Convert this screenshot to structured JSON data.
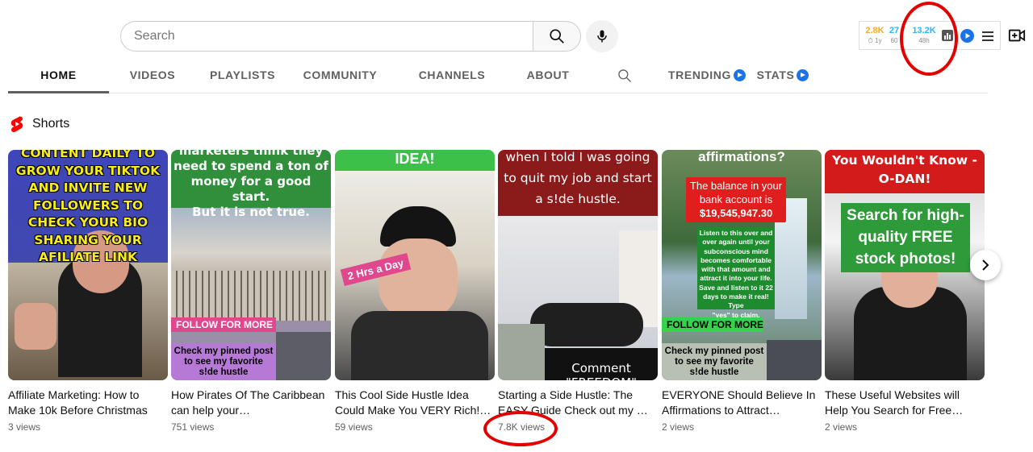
{
  "search": {
    "placeholder": "Search"
  },
  "extension": {
    "stat1": {
      "value": "2.8K",
      "sub": "1y",
      "color": "#f9a825"
    },
    "stat2": {
      "value": "27",
      "sub": "60",
      "color": "#29b6f6"
    },
    "stat3": {
      "value": "13.2K",
      "sub": "48h",
      "color": "#29b6f6"
    }
  },
  "tabs": [
    {
      "label": "HOME"
    },
    {
      "label": "VIDEOS"
    },
    {
      "label": "PLAYLISTS"
    },
    {
      "label": "COMMUNITY"
    },
    {
      "label": "CHANNELS"
    },
    {
      "label": "ABOUT"
    },
    {
      "label": "TRENDING"
    },
    {
      "label": "STATS"
    }
  ],
  "shorts": {
    "title": "Shorts",
    "items": [
      {
        "title": "Affiliate Marketing: How to Make 10k Before Christmas",
        "views": "3 views",
        "overlay": [
          "CONTENT DAILY TO",
          "GROW YOUR TIKTOK",
          "AND INVITE NEW",
          "FOLLOWERS TO",
          "CHECK YOUR BIO",
          "SHARING YOUR",
          "AFILIATE LINK"
        ]
      },
      {
        "title": "How Pirates Of The Caribbean can help your…",
        "views": "751 views",
        "overlay": [
          "marketers think they",
          "need to spend a ton of",
          "money for a good start.",
          "But it is not true."
        ],
        "follow": "FOLLOW FOR MORE",
        "pinned": [
          "Check my pinned post",
          "to see my favorite",
          "s!de hustle"
        ]
      },
      {
        "title": "This Cool Side Hustle Idea Could Make You VERY Rich!…",
        "views": "59 views",
        "overlay": [
          "IDEA!"
        ],
        "tag": "2 Hrs a Day"
      },
      {
        "title": "Starting a Side Hustle: The EASY Guide Check out my …",
        "views": "7.8K views",
        "overlay": [
          "when I told I was going",
          "to quit my job and start",
          "a s!de hustle."
        ],
        "comment": "Comment \"FREEDOM\""
      },
      {
        "title": "EVERYONE Should Believe In Affirmations to Attract…",
        "views": "2 views",
        "overlay": [
          "affirmations?"
        ],
        "balance": [
          "The balance in your",
          "bank account is",
          "$19,545,947.30"
        ],
        "listen": [
          "Listen to this over and",
          "over again until your",
          "subconscious mind",
          "becomes comfortable",
          "with that amount and",
          "attract it into your life.",
          "Save and listen to it 22",
          "days to make it real! Type",
          "\"yes\" to claim."
        ],
        "follow": "FOLLOW FOR MORE",
        "pinned": [
          "Check my pinned post",
          "to see my favorite",
          "s!de hustle"
        ]
      },
      {
        "title": "These Useful Websites will Help You Search for Free…",
        "views": "2 views",
        "overlay": [
          "You  Wouldn't Know -",
          "O-DAN!"
        ],
        "search_text": [
          "Search for high-",
          "quality FREE",
          "stock photos!"
        ]
      }
    ]
  }
}
